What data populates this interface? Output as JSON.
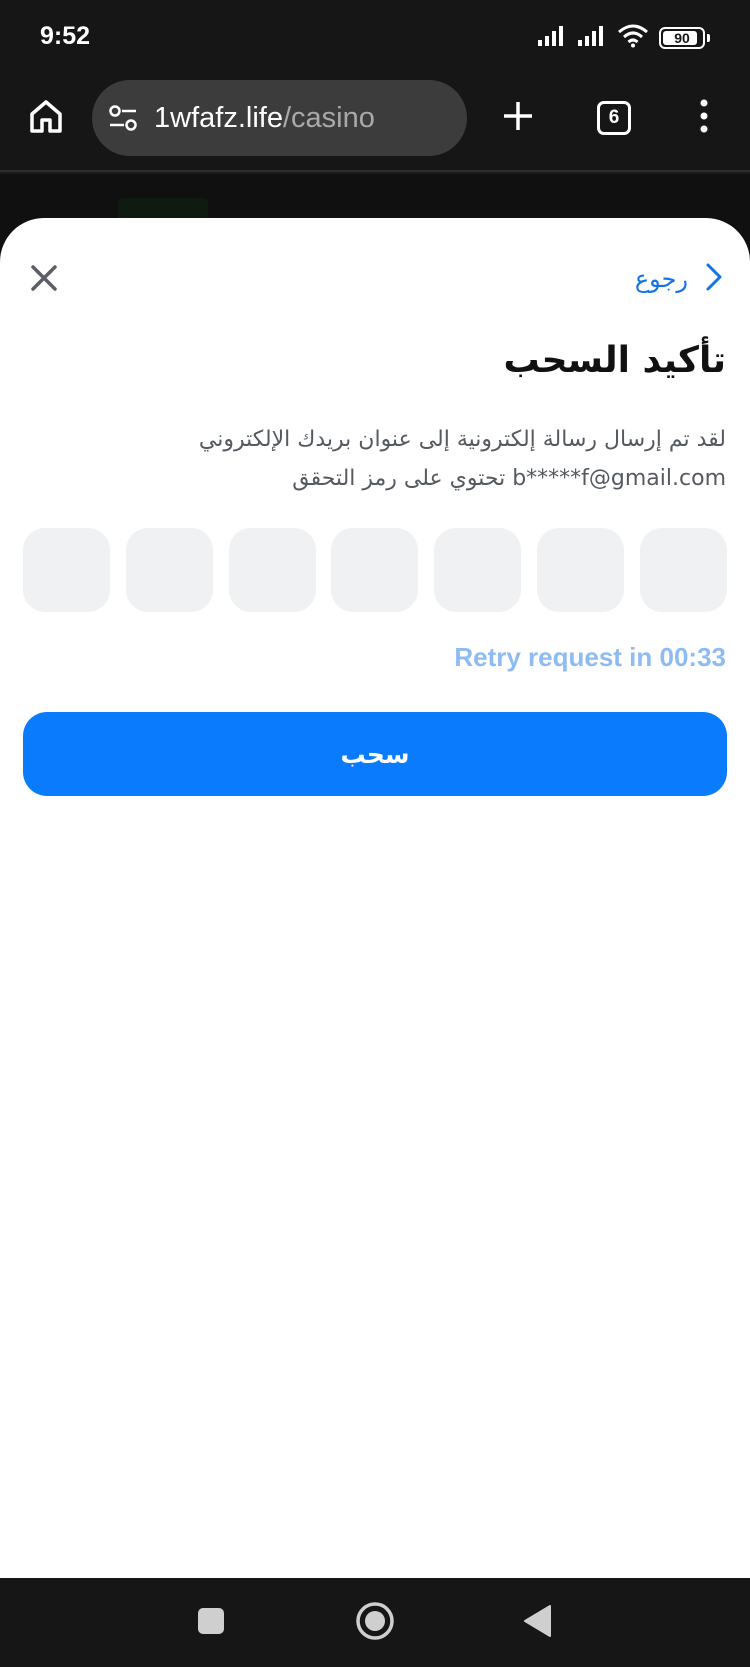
{
  "status_bar": {
    "time": "9:52",
    "battery_level": "90",
    "battery_fraction": 0.9
  },
  "browser": {
    "url_domain": "1wfafz.life",
    "url_path": "/casino",
    "tab_count": "6"
  },
  "sheet": {
    "back_label": "رجوع",
    "title": "تأكيد السحب",
    "description": "لقد تم إرسال رسالة إلكترونية إلى عنوان بريدك الإلكتروني b*****f@gmail.com تحتوي على رمز التحقق",
    "code_length": 7,
    "retry_text": "Retry request in 00:33",
    "submit_label": "سحب"
  },
  "colors": {
    "accent": "#0a7bfd",
    "link": "#1273e6",
    "retry": "#8ebcf2",
    "code_cell_bg": "#f0f1f3"
  },
  "icons": {
    "status": [
      "signal-icon",
      "signal-icon",
      "wifi-icon",
      "battery-icon"
    ],
    "browser": [
      "home-icon",
      "tune-icon",
      "plus-icon",
      "tabs-icon",
      "more-vert-icon"
    ],
    "sheet": [
      "close-icon",
      "chevron-right-icon"
    ],
    "nav": [
      "recents-icon",
      "home-circle-icon",
      "back-triangle-icon"
    ]
  }
}
